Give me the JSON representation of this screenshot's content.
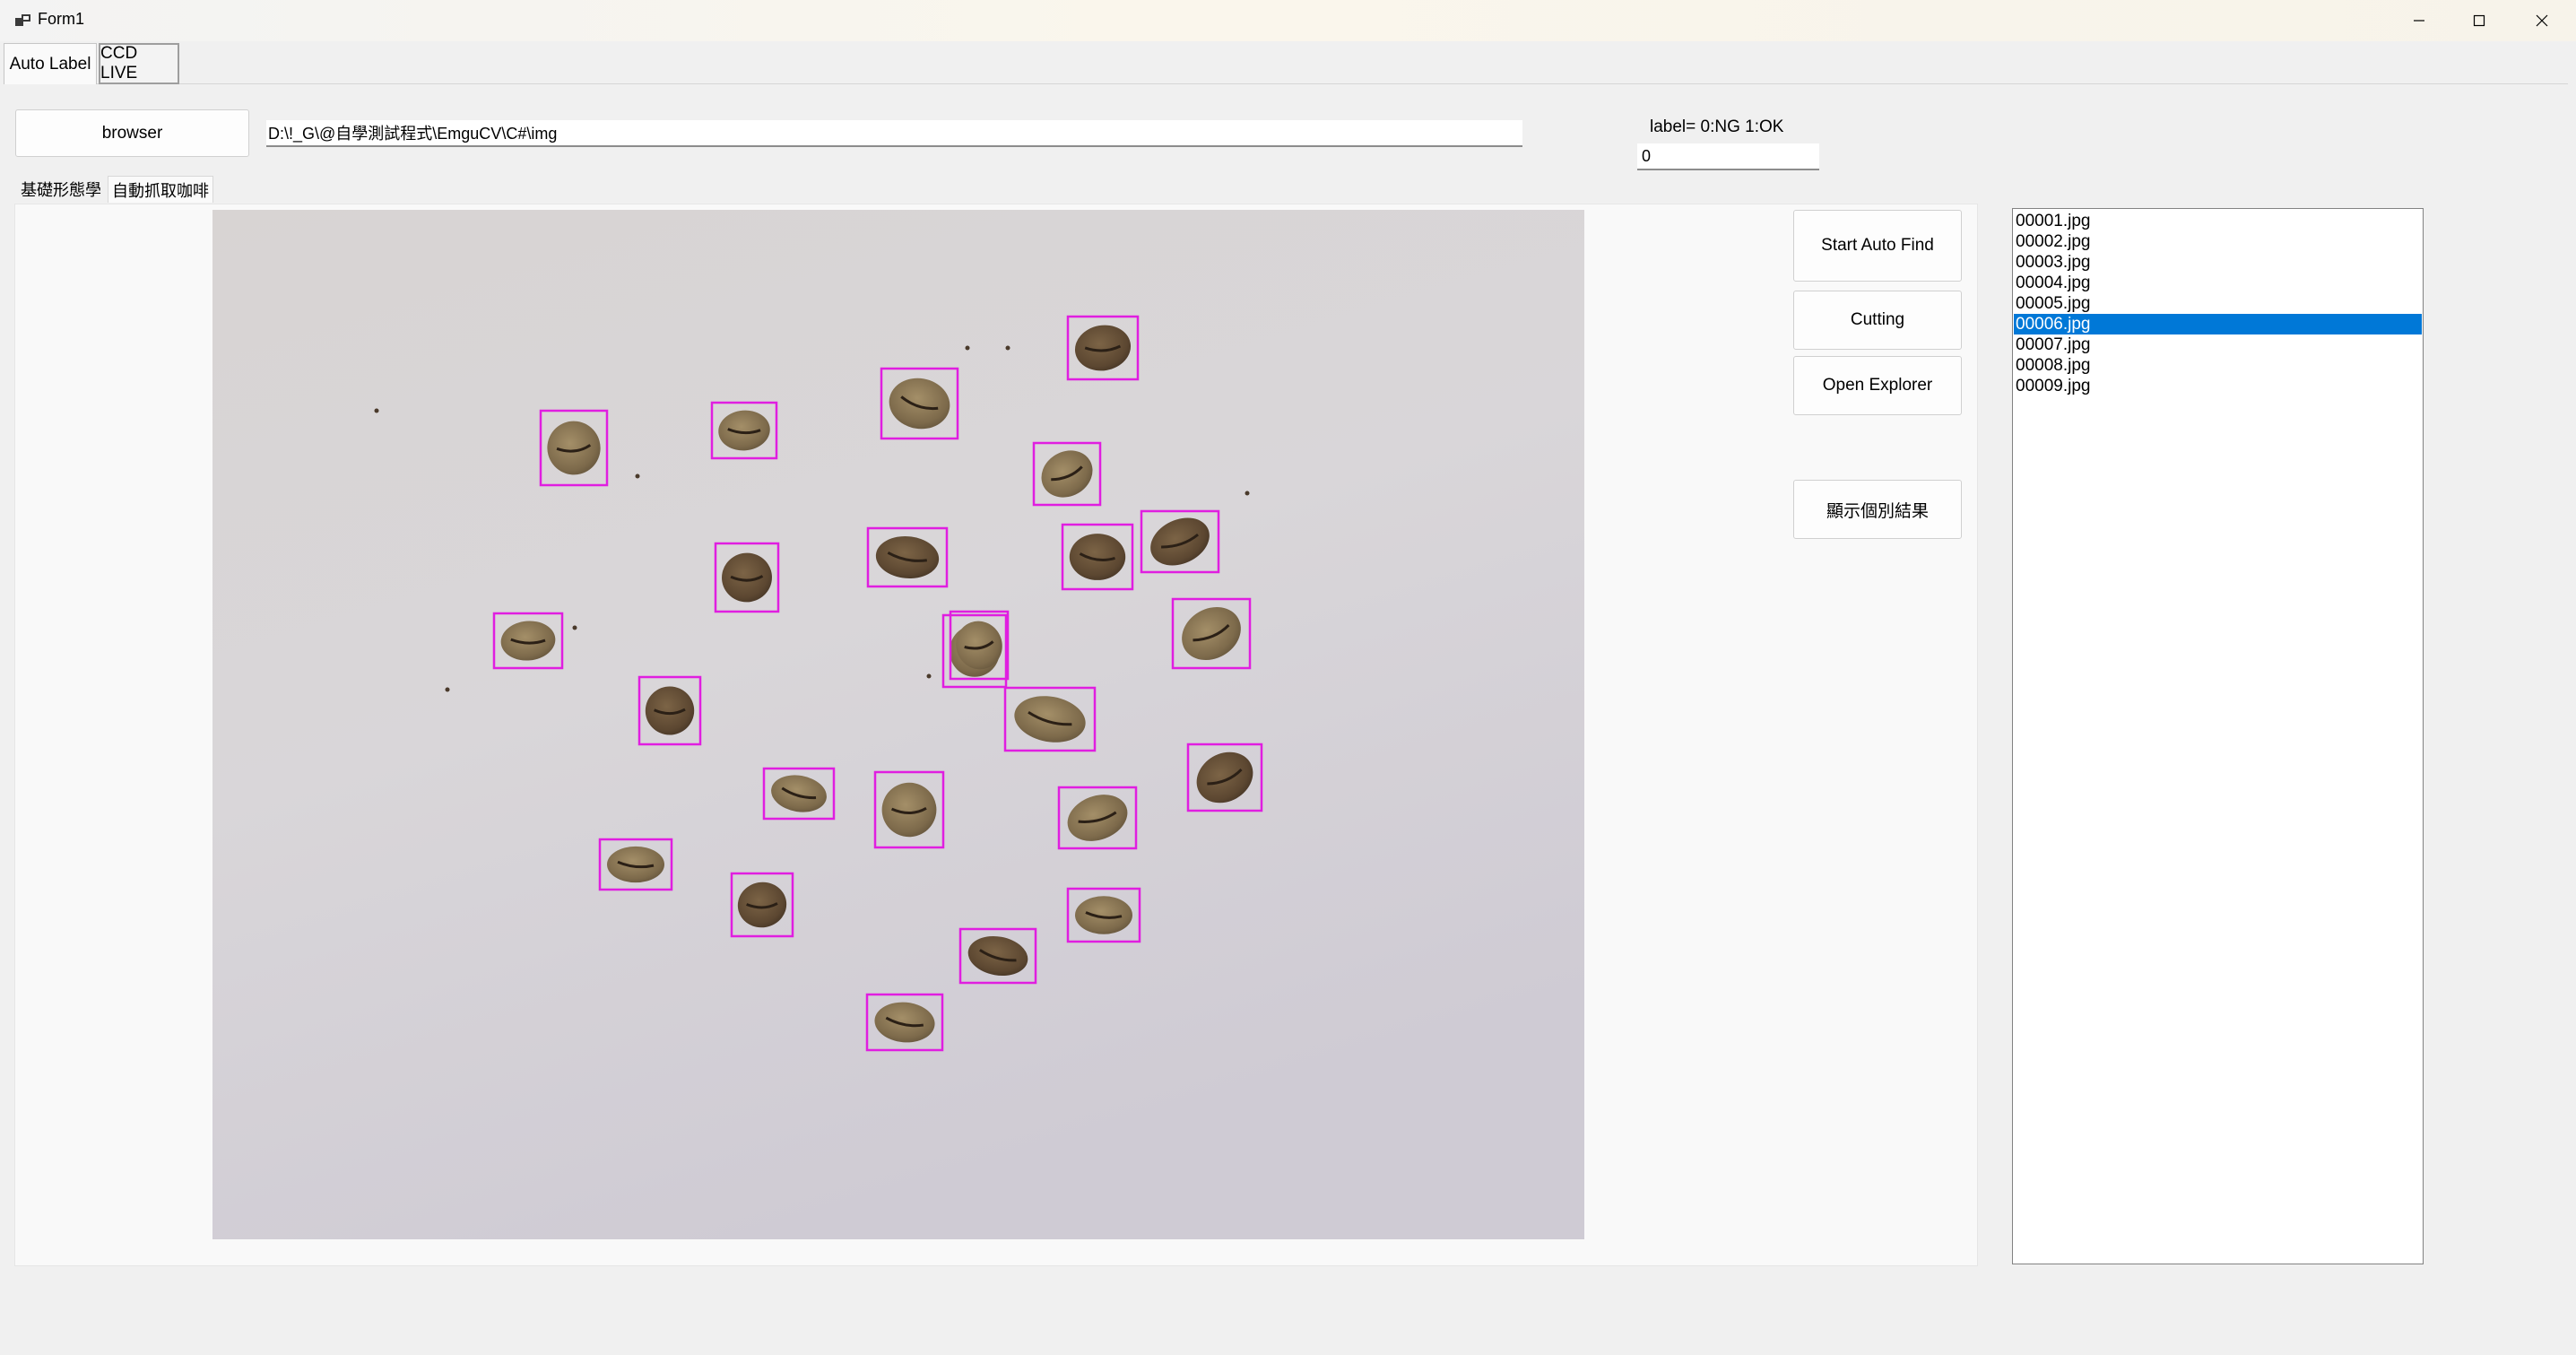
{
  "window": {
    "title": "Form1",
    "icon": "winforms-app-icon",
    "controls": [
      "minimize-icon",
      "maximize-icon",
      "close-icon"
    ]
  },
  "top_tabs": [
    {
      "label": "Auto Label",
      "selected": true
    },
    {
      "label": "CCD LIVE",
      "selected": false
    }
  ],
  "toolbar": {
    "browse_label": "browser",
    "path_value": "D:\\!_G\\@自學測試程式\\EmguCV\\C#\\img",
    "label_hint": "label= 0:NG 1:OK",
    "label_value": "0"
  },
  "sub_tabs": [
    {
      "label": "基礎形態學",
      "selected": false
    },
    {
      "label": "自動抓取咖啡",
      "selected": true
    }
  ],
  "actions": {
    "start_auto_find": "Start Auto Find",
    "cutting": "Cutting",
    "open_explorer": "Open Explorer",
    "show_results": "顯示個別結果"
  },
  "files": [
    {
      "name": "00001.jpg",
      "selected": false
    },
    {
      "name": "00002.jpg",
      "selected": false
    },
    {
      "name": "00003.jpg",
      "selected": false
    },
    {
      "name": "00004.jpg",
      "selected": false
    },
    {
      "name": "00005.jpg",
      "selected": false
    },
    {
      "name": "00006.jpg",
      "selected": true
    },
    {
      "name": "00007.jpg",
      "selected": false
    },
    {
      "name": "00008.jpg",
      "selected": false
    },
    {
      "name": "00009.jpg",
      "selected": false
    }
  ],
  "detection": {
    "box_color": "#e01ee0",
    "bean_count": 26
  },
  "colors": {
    "selection": "#0078d7",
    "background": "#f0f0f0"
  }
}
